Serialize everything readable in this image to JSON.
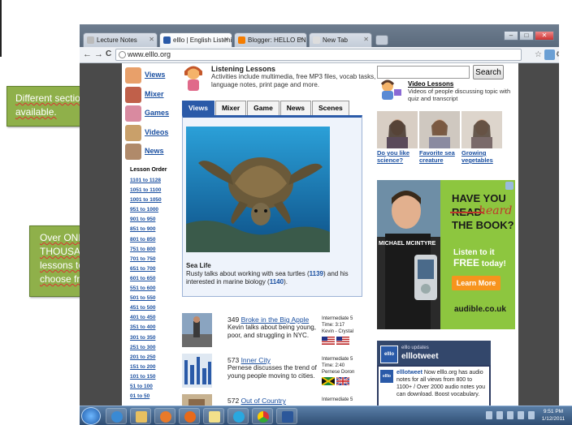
{
  "notes": {
    "sections": "Different sections available.",
    "lessons": "Over ONE THOUSAND lessons to choose from."
  },
  "browser": {
    "tabs": [
      {
        "title": "Lecture Notes",
        "favicon_color": "#bbbbbb"
      },
      {
        "title": "elllo | English Listening Onl",
        "favicon_color": "#2a5aa8"
      },
      {
        "title": "Blogger: HELLO ENGLISH -",
        "favicon_color": "#f57d00"
      },
      {
        "title": "New Tab",
        "favicon_color": "#dddddd"
      }
    ],
    "window_buttons": {
      "minimize": "–",
      "maximize": "□",
      "close": "✕"
    },
    "toolbar": {
      "back": "←",
      "forward": "→",
      "reload": "C",
      "url": "www.elllo.org"
    }
  },
  "site": {
    "sections": [
      {
        "label": "Views",
        "icon_color": "#e8a06a"
      },
      {
        "label": "Mixer",
        "icon_color": "#c0604a"
      },
      {
        "label": "Games",
        "icon_color": "#d98aa0"
      },
      {
        "label": "Videos",
        "icon_color": "#c9a06a"
      },
      {
        "label": "News",
        "icon_color": "#b08a6a"
      }
    ],
    "lesson_order_title": "Lesson Order",
    "lesson_ranges": [
      "1101 to 1128",
      "1051 to 1100",
      "1001 to 1050",
      "951 to 1000",
      "901 to 950",
      "851 to 900",
      "801 to 850",
      "751 to 800",
      "701 to 750",
      "651 to 700",
      "601 to 650",
      "551 to 600",
      "501 to 550",
      "451 to 500",
      "401 to 450",
      "351 to 400",
      "301 to 350",
      "251 to 300",
      "201 to 250",
      "151 to 200",
      "101 to 150",
      "51 to 100",
      "01 to 50"
    ],
    "listening": {
      "title": "Listening Lessons",
      "description": "Activities include multimedia, free MP3 files, vocab tasks, language notes, print page and more."
    },
    "content_tabs": [
      "Views",
      "Mixer",
      "Game",
      "News",
      "Scenes"
    ],
    "feature": {
      "title": "Sea Life",
      "desc_a": "Rusty talks about working with sea turtles (",
      "link_a": "1139",
      "desc_b": ") and his interested in marine biology (",
      "link_b": "1140",
      "desc_c": ")."
    },
    "lesson_items": [
      {
        "num": "349",
        "title": "Broke in the Big Apple",
        "desc": "Kevin talks about being young, poor, and struggling in NYC.",
        "level": "Intermediate 5",
        "time": "Time: 3:17",
        "speakers": "Kevin - Crystal"
      },
      {
        "num": "573",
        "title": "Inner City",
        "desc": "Pernese discusses the trend of young people moving to cities.",
        "level": "Intermediate 5",
        "time": "Time: 2:40",
        "speakers": "Pernese Doron"
      },
      {
        "num": "572",
        "title": "Out of Country",
        "desc": "",
        "level": "Intermediate 5",
        "time": "",
        "speakers": ""
      }
    ],
    "search": {
      "button": "Search",
      "placeholder": ""
    },
    "video_lessons": {
      "title": "Video Lessons",
      "description": "Videos of people discussing topic with quiz and transcript"
    },
    "videos": [
      "Do you like science?",
      "Favorite sea creature",
      "Growing vegetables"
    ],
    "ad": {
      "line1": "HAVE YOU",
      "struck": "READ",
      "heard": "heard",
      "line3": "THE BOOK?",
      "listen": "Listen to it",
      "free": "FREE",
      "today": "today!",
      "button": "Learn More",
      "brand": "audible.co.uk",
      "name": "MICHAEL MCINTYRE"
    },
    "updates": {
      "logo": "elllo",
      "label": "elllo updates",
      "handle": "elllotweet",
      "tweet_handle": "elllotweet",
      "tweet_text": " Now elllo.org has audio notes for all views from 800 to 1100+ / Over 2000 audio notes you can download. Boost vocabulary."
    }
  },
  "taskbar": {
    "time": "9:51 PM",
    "date": "1/12/2011"
  }
}
